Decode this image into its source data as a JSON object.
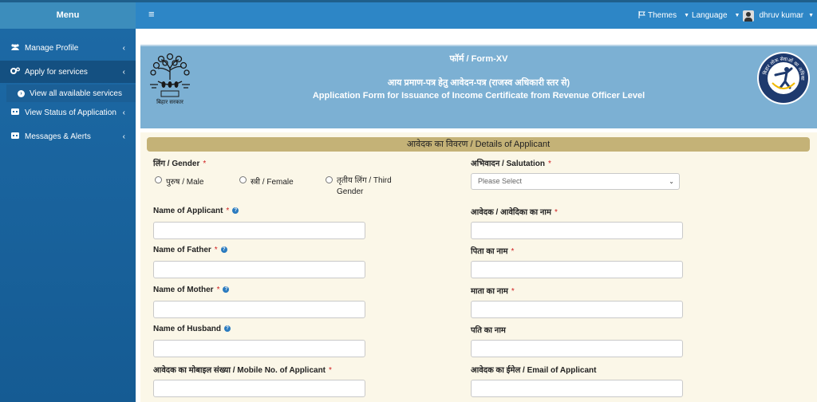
{
  "sidebar": {
    "title": "Menu",
    "items": [
      {
        "label": "Manage Profile",
        "icon": "users-icon"
      },
      {
        "label": "Apply for services",
        "icon": "cogs-icon"
      },
      {
        "label": "View Status of Application",
        "icon": "status-icon"
      },
      {
        "label": "Messages & Alerts",
        "icon": "message-icon"
      }
    ],
    "sub_item": "View all available services"
  },
  "header": {
    "themes": "Themes",
    "language": "Language",
    "user": "dhruv kumar"
  },
  "banner": {
    "form_no": "फॉर्म / Form-XV",
    "title_hindi": "आय प्रमाण-पत्र हेतु आवेदन-पत्र (राजस्व अधिकारी स्तर से)",
    "title_english": "Application Form for Issuance of Income Certificate from Revenue Officer Level",
    "emblem_caption": "बिहार सरकार",
    "logo_text": "बिहार लोक सेवाओं का अधिकार"
  },
  "form": {
    "section_title": "आवेदक का विवरण / Details of Applicant",
    "gender_label": "लिंग / Gender",
    "gender_options": [
      "पुरुष / Male",
      "स्त्री / Female",
      "तृतीय लिंग / Third Gender"
    ],
    "salutation_label": "अभिवादन / Salutation",
    "salutation_value": "Please Select",
    "name_applicant_label": "Name of Applicant",
    "name_applicant_hindi_label": "आवेदक / आवेदिका का नाम",
    "father_label": "Name of Father",
    "father_hindi_label": "पिता का नाम",
    "mother_label": "Name of Mother",
    "mother_hindi_label": "माता का नाम",
    "husband_label": "Name of Husband",
    "husband_hindi_label": "पति का नाम",
    "mobile_label": "आवेदक का मोबाइल संख्या / Mobile No. of Applicant",
    "email_label": "आवेदक का ईमेल / Email of Applicant",
    "required_mark": "*",
    "info_mark": "?"
  },
  "colors": {
    "sidebar": "#1d6aa6",
    "header": "#2d86c6",
    "banner": "#7cb0d3",
    "section_header": "#c4b277",
    "form_bg": "#fbf7e8"
  }
}
